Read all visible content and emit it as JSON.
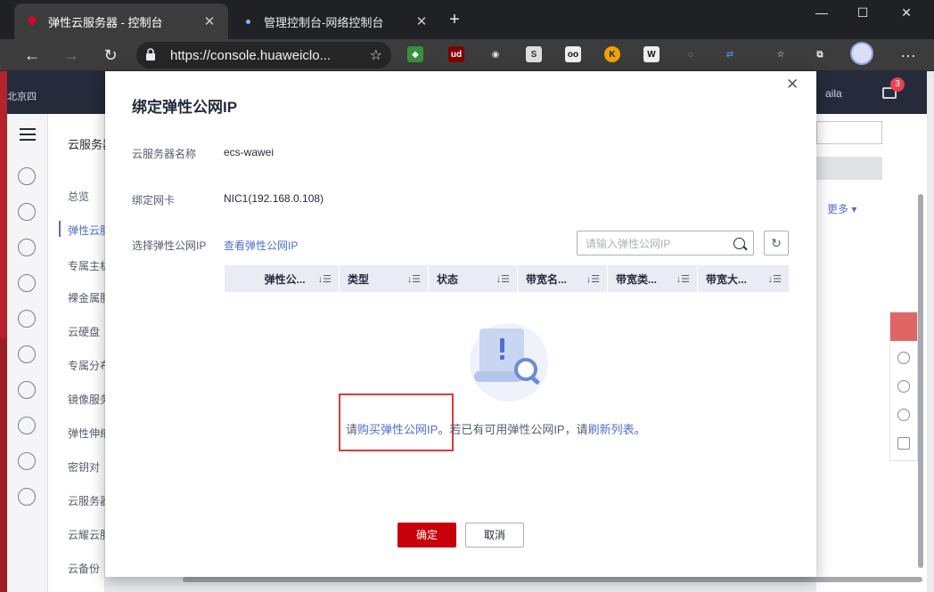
{
  "browser": {
    "tabs": [
      {
        "title": "弹性云服务器 - 控制台",
        "active": true
      },
      {
        "title": "管理控制台-网络控制台",
        "active": false
      }
    ],
    "url": "https://console.huaweiclo...",
    "extensions": [
      "ext-green",
      "ud",
      "ghost",
      "S",
      "oo",
      "k",
      "W",
      "circle",
      "shuffle"
    ],
    "colors": {
      "tabbar": "#202124",
      "toolbar": "#3c3c3c"
    }
  },
  "console": {
    "crumb": "北京四",
    "user": "aila",
    "mail_badge": "3",
    "side_head": "云服务器",
    "side_items": [
      "总览",
      "弹性云服",
      "专属主机",
      "裸金属服",
      "云硬盘",
      "专属分布",
      "镜像服务",
      "弹性伸缩",
      "密钥对",
      "云服务器",
      "云耀云服",
      "云备份"
    ],
    "more": "更多"
  },
  "modal": {
    "title": "绑定弹性公网IP",
    "server_name_label": "云服务器名称",
    "server_name_value": "ecs-wawei",
    "nic_label": "绑定网卡",
    "nic_value": "NIC1(192.168.0.108)",
    "eip_label": "选择弹性公网IP",
    "view_eip_link": "查看弹性公网IP",
    "search_placeholder": "请输入弹性公网IP",
    "columns": [
      "弹性公...",
      "类型",
      "状态",
      "带宽名...",
      "带宽类...",
      "带宽大..."
    ],
    "empty": {
      "prefix": "请",
      "buy_link": "购买弹性公网IP",
      "middle": "。若已有可用弹性公网IP，请",
      "refresh_link": "刷新列表",
      "suffix": "。"
    },
    "ok": "确定",
    "cancel": "取消",
    "colors": {
      "primary": "#c7000b",
      "link": "#526ecc",
      "highlight": "#e23a3a"
    }
  }
}
